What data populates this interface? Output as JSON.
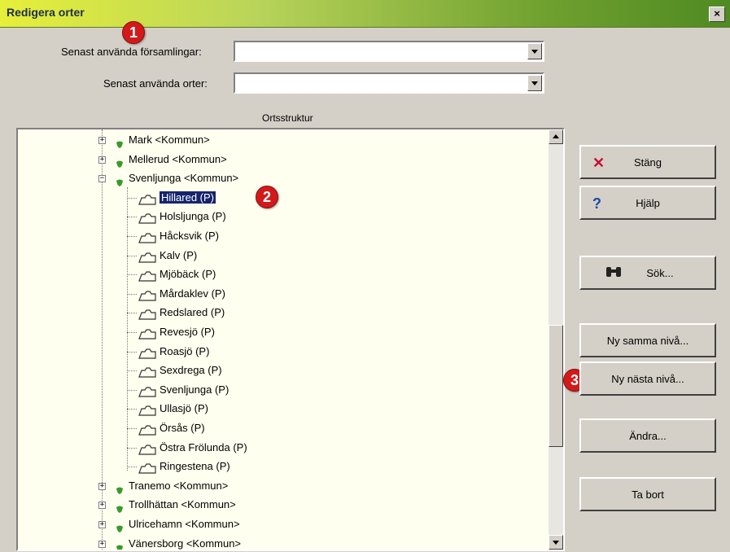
{
  "window": {
    "title": "Redigera orter",
    "close_label": "×"
  },
  "badges": [
    "1",
    "2",
    "3"
  ],
  "fields": {
    "recent_parishes_label": "Senast använda församlingar:",
    "recent_parishes_value": "",
    "recent_places_label": "Senast använda orter:",
    "recent_places_value": ""
  },
  "tree": {
    "header": "Ortsstruktur",
    "items": [
      {
        "label": "Mark <Kommun>",
        "type": "kommun",
        "expander": "+"
      },
      {
        "label": "Mellerud <Kommun>",
        "type": "kommun",
        "expander": "+"
      },
      {
        "label": "Svenljunga <Kommun>",
        "type": "kommun",
        "expander": "−"
      },
      {
        "label": "Hillared (P)",
        "type": "parish",
        "selected": true
      },
      {
        "label": "Holsljunga (P)",
        "type": "parish"
      },
      {
        "label": "Håcksvik (P)",
        "type": "parish"
      },
      {
        "label": "Kalv (P)",
        "type": "parish"
      },
      {
        "label": "Mjöbäck (P)",
        "type": "parish"
      },
      {
        "label": "Mårdaklev (P)",
        "type": "parish"
      },
      {
        "label": "Redslared (P)",
        "type": "parish"
      },
      {
        "label": "Revesjö (P)",
        "type": "parish"
      },
      {
        "label": "Roasjö (P)",
        "type": "parish"
      },
      {
        "label": "Sexdrega (P)",
        "type": "parish"
      },
      {
        "label": "Svenljunga (P)",
        "type": "parish"
      },
      {
        "label": "Ullasjö (P)",
        "type": "parish"
      },
      {
        "label": "Örsås (P)",
        "type": "parish"
      },
      {
        "label": "Östra Frölunda (P)",
        "type": "parish"
      },
      {
        "label": "Ringestena (P)",
        "type": "parish"
      },
      {
        "label": "Tranemo <Kommun>",
        "type": "kommun",
        "expander": "+"
      },
      {
        "label": "Trollhättan <Kommun>",
        "type": "kommun",
        "expander": "+"
      },
      {
        "label": "Ulricehamn <Kommun>",
        "type": "kommun",
        "expander": "+"
      },
      {
        "label": "Vänersborg <Kommun>",
        "type": "kommun",
        "expander": "+"
      }
    ]
  },
  "buttons": {
    "close": {
      "label": "Stäng",
      "icon": "close-icon",
      "color": "#c8102e"
    },
    "help": {
      "label": "Hjälp",
      "icon": "help-icon",
      "color": "#1a49a8"
    },
    "search": {
      "label": "Sök...",
      "icon": "binoculars-icon"
    },
    "new_same_level": {
      "label": "Ny samma nivå..."
    },
    "new_next_level": {
      "label": "Ny nästa nivå..."
    },
    "edit": {
      "label": "Ändra..."
    },
    "delete": {
      "label": "Ta bort"
    }
  },
  "colors": {
    "accent_green": "#3a9a2a",
    "selection": "#16246b"
  }
}
